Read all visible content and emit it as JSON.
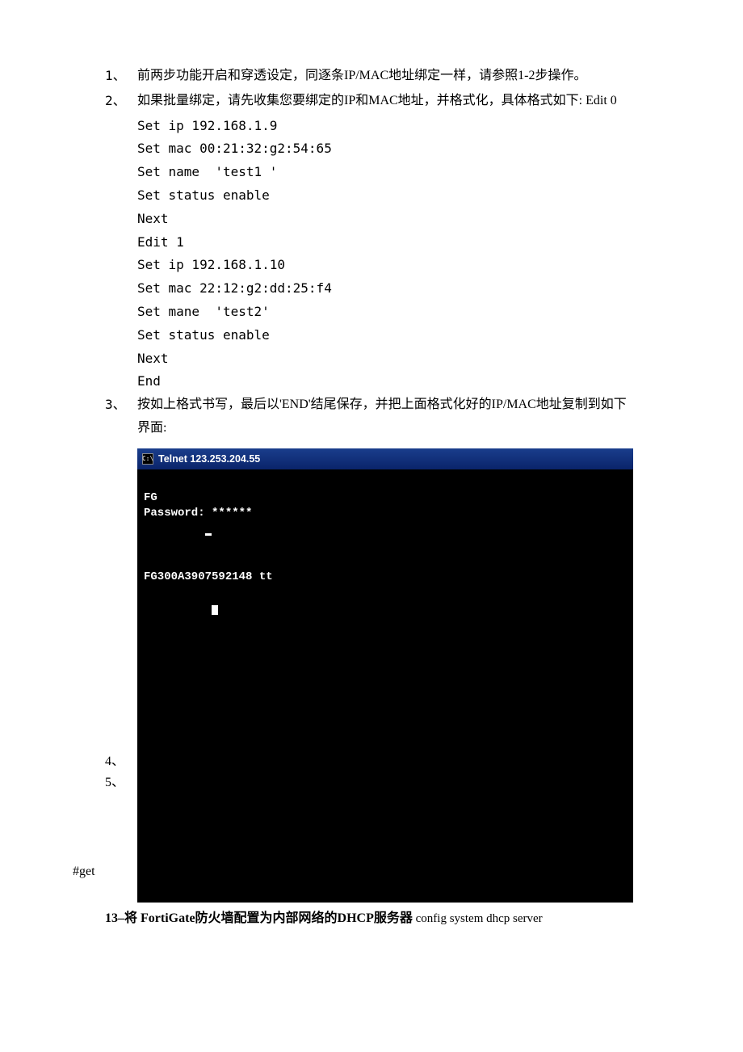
{
  "items": {
    "i1": {
      "num": "1、",
      "text": "前两步功能开启和穿透设定，同逐条IP/MAC地址绑定一样，请参照1-2步操作。"
    },
    "i2": {
      "num": "2、",
      "text": "如果批量绑定，请先收集您要绑定的IP和MAC地址，并格式化，具体格式如下: Edit 0",
      "code": {
        "l1": "Set ip 192.168.1.9",
        "l2": "Set mac 00:21:32:g2:54:65",
        "l3": "Set name  'test1 '",
        "l4": "Set status enable",
        "l5": "Next",
        "l6": "Edit 1",
        "l7": "Set ip 192.168.1.10",
        "l8": "Set mac 22:12:g2:dd:25:f4",
        "l9": "Set mane  'test2'",
        "l10": "Set status enable",
        "l11": "Next",
        "l12": "",
        "l13": "End"
      }
    },
    "i3": {
      "num": "3、",
      "text": "按如上格式书写，最后以'END'结尾保存，并把上面格式化好的IP/MAC地址复制到如下界面:"
    },
    "i4": {
      "num": "4、"
    },
    "i5": {
      "num": "5、"
    },
    "get": "#get"
  },
  "terminal": {
    "icon_label": "cmd-icon",
    "icon_text": "C:\\",
    "title": "Telnet 123.253.204.55",
    "lines": {
      "l1": "",
      "l2": "FG",
      "l3": "Password: ******",
      "l4": "         ",
      "l5": "",
      "l6": "",
      "l7": "FG300A3907592148 tt",
      "l8": "",
      "l9": ""
    }
  },
  "heading": {
    "num": "13–将 ",
    "bold": "FortiGate防火墙配置为内部网络的DHCP服务器",
    "cmd": "  config system dhcp server"
  }
}
